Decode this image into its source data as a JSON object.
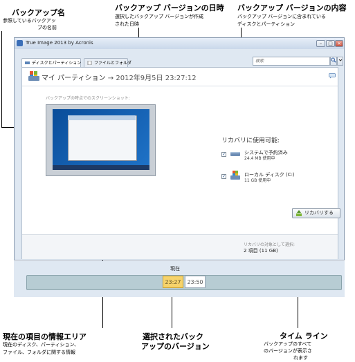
{
  "annotations": {
    "backup_name": {
      "title": "バックアップ名",
      "desc1": "参照しているバックアッ",
      "desc2": "プの名前"
    },
    "version_date": {
      "title": "バックアップ バージョンの日時",
      "desc1": "選択したバックアップ バージョンが作成",
      "desc2": "された日時"
    },
    "version_contents": {
      "title": "バックアップ バージョンの内容",
      "desc1": "バックアップ バージョンに含まれている",
      "desc2": "ディスクとパーティション"
    },
    "info_area": {
      "title": "現在の項目の情報エリア",
      "desc1": "現在のディスク、パーティション、",
      "desc2": "ファイル、フォルダに関する情報"
    },
    "selected_version": {
      "title1": "選択されたバック",
      "title2": "アップのバージョン"
    },
    "timeline": {
      "title": "タイム ライン",
      "desc1": "バックアップのすべて",
      "desc2": "のバージョンが表示さ",
      "desc3": "れます"
    }
  },
  "window": {
    "title": "True Image 2013 by Acronis",
    "tabs": [
      {
        "label": "ディスクとパーティション",
        "active": true
      },
      {
        "label": "ファイルとフォルダ",
        "active": false
      }
    ],
    "search_placeholder": "検索",
    "search_btn_icon": "search-icon",
    "dropdown_icon": "chevron-down-icon"
  },
  "backup": {
    "name": "マイ パーティション",
    "arrow": "→",
    "datetime": "2012年9月5日 23:27:12"
  },
  "screenshot_label": "バックアップの時点でのスクリーンショット:",
  "recovery": {
    "title": "リカバリに使用可能:",
    "items": [
      {
        "name": "システムで予約済み",
        "size": "24.4 MB 使用中",
        "checked": true,
        "icon": "disk-icon"
      },
      {
        "name": "ローカル ディスク (C:)",
        "size": "11 GB 使用中",
        "checked": true,
        "icon": "windows-disk-icon"
      }
    ]
  },
  "footer": {
    "selected_label": "リカバリの対象として選択:",
    "selected_value": "2 項目 (11 GB)",
    "recover_button": "リカバリする"
  },
  "timeline": {
    "now_label": "現在",
    "versions": [
      {
        "time": "23:27",
        "selected": true
      },
      {
        "time": "23:50",
        "selected": false
      }
    ]
  },
  "colors": {
    "window_bg": "#dfe8f2",
    "timeline": "#b7ccd3",
    "selected_version": "#f6d36b"
  }
}
